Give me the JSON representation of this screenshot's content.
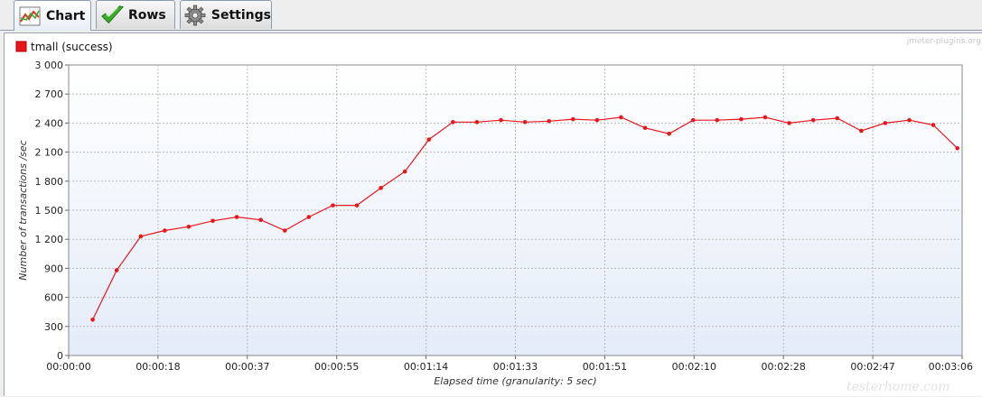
{
  "tabs": [
    {
      "label": "Chart",
      "icon": "line-chart-icon",
      "active": true
    },
    {
      "label": "Rows",
      "icon": "checkmark-icon",
      "active": false
    },
    {
      "label": "Settings",
      "icon": "gear-icon",
      "active": false
    }
  ],
  "watermark": "jmeter-plugins.org",
  "stamp": "testerhome.com",
  "colors": {
    "series": "#e8161d",
    "plot_bg_top": "#ffffff",
    "plot_bg_bottom": "#e4ecf8",
    "grid": "#b9b9b9"
  },
  "chart_data": {
    "type": "line",
    "title": "",
    "xlabel": "Elapsed time (granularity: 5 sec)",
    "ylabel": "Number of transactions /sec",
    "ylim": [
      0,
      3000
    ],
    "yticks": [
      0,
      300,
      600,
      900,
      1200,
      1500,
      1800,
      2100,
      2400,
      2700,
      3000
    ],
    "ytick_labels": [
      "0",
      "300",
      "600",
      "900",
      "1 200",
      "1 500",
      "1 800",
      "2 100",
      "2 400",
      "2 700",
      "3 000"
    ],
    "xlim_seconds": [
      0,
      186
    ],
    "xtick_labels": [
      "00:00:00",
      "00:00:18",
      "00:00:37",
      "00:00:55",
      "00:01:14",
      "00:01:33",
      "00:01:51",
      "00:02:10",
      "00:02:28",
      "00:02:47",
      "00:03:06"
    ],
    "grid": true,
    "legend_position": "top-left",
    "series": [
      {
        "name": "tmall (success)",
        "color": "#e8161d",
        "x": [
          5,
          10,
          15,
          20,
          25,
          30,
          35,
          40,
          45,
          50,
          55,
          60,
          65,
          70,
          75,
          80,
          85,
          90,
          95,
          100,
          105,
          110,
          115,
          120,
          125,
          130,
          135,
          140,
          145,
          150,
          155,
          160,
          165,
          170,
          175,
          180,
          185
        ],
        "y": [
          370,
          880,
          1230,
          1290,
          1330,
          1390,
          1430,
          1400,
          1290,
          1430,
          1550,
          1550,
          1730,
          1900,
          2230,
          2410,
          2410,
          2430,
          2410,
          2420,
          2440,
          2430,
          2460,
          2350,
          2290,
          2430,
          2430,
          2440,
          2460,
          2400,
          2430,
          2450,
          2320,
          2400,
          2430,
          2380,
          2140
        ]
      }
    ]
  }
}
